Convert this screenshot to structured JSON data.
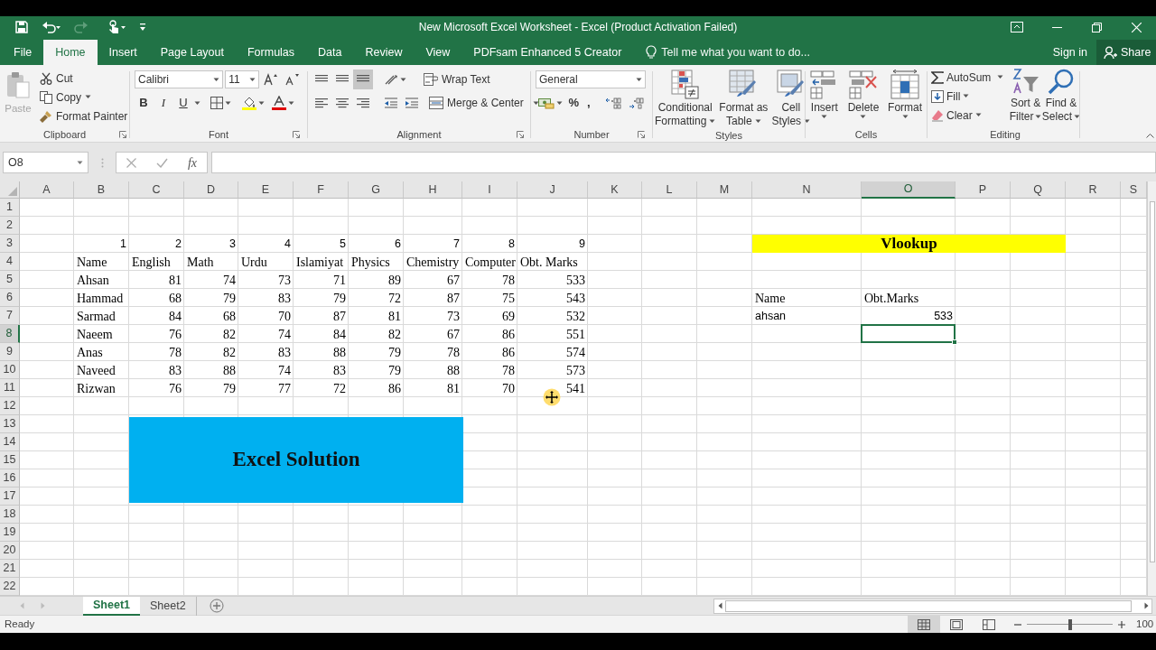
{
  "window": {
    "title": "New Microsoft Excel Worksheet - Excel (Product Activation Failed)"
  },
  "menu_tabs": [
    {
      "label": "File",
      "selected": false
    },
    {
      "label": "Home",
      "selected": true
    },
    {
      "label": "Insert",
      "selected": false
    },
    {
      "label": "Page Layout",
      "selected": false
    },
    {
      "label": "Formulas",
      "selected": false
    },
    {
      "label": "Data",
      "selected": false
    },
    {
      "label": "Review",
      "selected": false
    },
    {
      "label": "View",
      "selected": false
    },
    {
      "label": "PDFsam Enhanced 5 Creator",
      "selected": false
    }
  ],
  "tell_me": {
    "placeholder": "Tell me what you want to do..."
  },
  "account": {
    "sign_in": "Sign in",
    "share": "Share"
  },
  "clipboard": {
    "label": "Clipboard",
    "paste": {
      "label": "Paste",
      "disabled": true
    },
    "cut": "Cut",
    "copy": "Copy",
    "format_painter": "Format Painter"
  },
  "font": {
    "label": "Font",
    "family": "Calibri",
    "size": "11",
    "styles": [
      "B",
      "I",
      "U"
    ]
  },
  "alignment": {
    "label": "Alignment",
    "wrap_text": "Wrap Text",
    "merge_center": "Merge & Center"
  },
  "number": {
    "label": "Number",
    "format": "General",
    "symbols": [
      "%",
      ","
    ]
  },
  "styles": {
    "label": "Styles",
    "buttons": [
      [
        "Conditional",
        "Formatting"
      ],
      [
        "Format as",
        "Table"
      ],
      [
        "Cell",
        "Styles"
      ]
    ]
  },
  "cells": {
    "label": "Cells",
    "buttons": [
      "Insert",
      "Delete",
      "Format"
    ]
  },
  "editing": {
    "label": "Editing",
    "autosum": "AutoSum",
    "fill": "Fill",
    "clear": "Clear",
    "sort_filter": [
      "Sort &",
      "Filter"
    ],
    "find_select": [
      "Find &",
      "Select"
    ]
  },
  "formula_bar": {
    "name_box": "O8",
    "function_label": "fx"
  },
  "sheet": {
    "columns": [
      {
        "label": "A",
        "selected": false
      },
      {
        "label": "B",
        "selected": false
      },
      {
        "label": "C",
        "selected": false
      },
      {
        "label": "D",
        "selected": false
      },
      {
        "label": "E",
        "selected": false
      },
      {
        "label": "F",
        "selected": false
      },
      {
        "label": "G",
        "selected": false
      },
      {
        "label": "H",
        "selected": false
      },
      {
        "label": "I",
        "selected": false
      },
      {
        "label": "J",
        "selected": false
      },
      {
        "label": "K",
        "selected": false
      },
      {
        "label": "L",
        "selected": false
      },
      {
        "label": "M",
        "selected": false
      },
      {
        "label": "N",
        "selected": false
      },
      {
        "label": "O",
        "selected": true
      },
      {
        "label": "P",
        "selected": false
      },
      {
        "label": "Q",
        "selected": false
      },
      {
        "label": "R",
        "selected": false
      },
      {
        "label": "S",
        "selected": false
      }
    ],
    "rows": [
      {
        "label": "1",
        "selected": false
      },
      {
        "label": "2",
        "selected": false
      },
      {
        "label": "3",
        "selected": false
      },
      {
        "label": "4",
        "selected": false
      },
      {
        "label": "5",
        "selected": false
      },
      {
        "label": "6",
        "selected": false
      },
      {
        "label": "7",
        "selected": false
      },
      {
        "label": "8",
        "selected": true
      },
      {
        "label": "9",
        "selected": false
      },
      {
        "label": "10",
        "selected": false
      },
      {
        "label": "11",
        "selected": false
      },
      {
        "label": "12",
        "selected": false
      },
      {
        "label": "13",
        "selected": false
      },
      {
        "label": "14",
        "selected": false
      },
      {
        "label": "15",
        "selected": false
      },
      {
        "label": "16",
        "selected": false
      },
      {
        "label": "17",
        "selected": false
      },
      {
        "label": "18",
        "selected": false
      },
      {
        "label": "19",
        "selected": false
      },
      {
        "label": "20",
        "selected": false
      },
      {
        "label": "21",
        "selected": false
      },
      {
        "label": "22",
        "selected": false
      }
    ]
  },
  "marks_table": {
    "column_numbers": [
      "1",
      "2",
      "3",
      "4",
      "5",
      "6",
      "7",
      "8",
      "9"
    ],
    "headings": [
      "Name",
      "English",
      "Math",
      "Urdu",
      "Islamiyat",
      "Physics",
      "Chemistry",
      "Computer",
      "Obt. Marks"
    ],
    "rows": [
      [
        "Ahsan",
        "81",
        "74",
        "73",
        "71",
        "89",
        "67",
        "78",
        "533"
      ],
      [
        "Hammad",
        "68",
        "79",
        "83",
        "79",
        "72",
        "87",
        "75",
        "543"
      ],
      [
        "Sarmad",
        "84",
        "68",
        "70",
        "87",
        "81",
        "73",
        "69",
        "532"
      ],
      [
        "Naeem",
        "76",
        "82",
        "74",
        "84",
        "82",
        "67",
        "86",
        "551"
      ],
      [
        "Anas",
        "78",
        "82",
        "83",
        "88",
        "79",
        "78",
        "86",
        "574"
      ],
      [
        "Naveed",
        "83",
        "88",
        "74",
        "83",
        "79",
        "88",
        "78",
        "573"
      ],
      [
        "Rizwan",
        "76",
        "79",
        "77",
        "72",
        "86",
        "81",
        "70",
        "541"
      ]
    ]
  },
  "vlookup": {
    "title": "Vlookup",
    "labels": [
      "Name",
      "Obt.Marks"
    ],
    "lookup_name": "ahsan",
    "result": "533"
  },
  "shape": {
    "text": "Excel Solution"
  },
  "sheet_tabs": [
    {
      "label": "Sheet1",
      "selected": true
    },
    {
      "label": "Sheet2",
      "selected": false
    }
  ],
  "status_bar": {
    "text": "Ready",
    "zoom": {
      "level": 0.5,
      "reading": "100"
    }
  }
}
